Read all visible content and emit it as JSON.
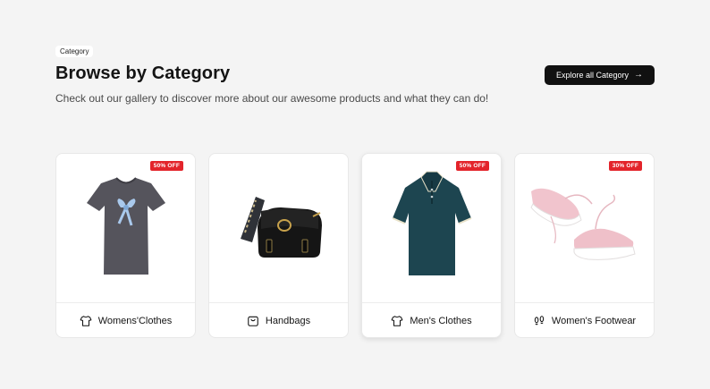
{
  "section": {
    "badge": "Category",
    "title": "Browse by Category",
    "subtitle": "Check out our gallery to discover more about our awesome products and what they can do!",
    "explore_label": "Explore all Category",
    "explore_icon": "arrow-right-icon"
  },
  "cards": [
    {
      "label": "Womens'Clothes",
      "discount": "50% OFF",
      "icon": "shirt-icon"
    },
    {
      "label": "Handbags",
      "discount": "",
      "icon": "bag-icon"
    },
    {
      "label": "Men's Clothes",
      "discount": "50% OFF",
      "icon": "shirt-icon"
    },
    {
      "label": "Women's Footwear",
      "discount": "30% OFF",
      "icon": "footprints-icon"
    }
  ],
  "colors": {
    "background": "#f4f4f4",
    "button": "#111111",
    "discount": "#e3242b"
  }
}
